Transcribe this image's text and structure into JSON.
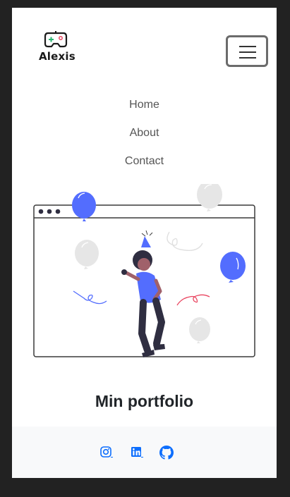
{
  "brand": {
    "name": "Alexis",
    "icon": "gamepad-icon"
  },
  "navbar": {
    "toggler_icon": "hamburger-icon"
  },
  "nav": {
    "items": [
      {
        "label": "Home"
      },
      {
        "label": "About"
      },
      {
        "label": "Contact"
      }
    ]
  },
  "hero": {
    "illustration": "party-woman-illustration"
  },
  "main": {
    "title": "Min portfolio"
  },
  "footer": {
    "social": [
      {
        "icon": "instagram-icon"
      },
      {
        "icon": "linkedin-icon"
      },
      {
        "icon": "github-icon"
      }
    ],
    "link_color": "#0d6efd"
  },
  "colors": {
    "accent": "#536dfe",
    "dark": "#2f2e41",
    "balloon_gray": "#e6e6e6",
    "footer_bg": "#f8f9fa"
  }
}
